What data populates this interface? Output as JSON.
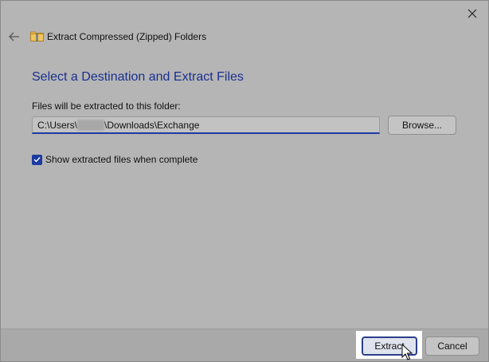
{
  "window": {
    "title": "Extract Compressed (Zipped) Folders",
    "close_icon": "close-icon",
    "back_icon": "back-arrow-icon",
    "app_icon": "zip-folder-icon"
  },
  "main": {
    "heading": "Select a Destination and Extract Files",
    "path_label": "Files will be extracted to this folder:",
    "path_prefix": "C:\\Users\\",
    "path_suffix": "\\Downloads\\Exchange",
    "browse_label": "Browse...",
    "show_files_checkbox": {
      "label": "Show extracted files when complete",
      "checked": true
    }
  },
  "footer": {
    "extract_label": "Extract",
    "cancel_label": "Cancel"
  },
  "colors": {
    "accent": "#1c3aa0",
    "heading": "#1a2f8f",
    "dialog_bg": "#b5b5b5"
  }
}
